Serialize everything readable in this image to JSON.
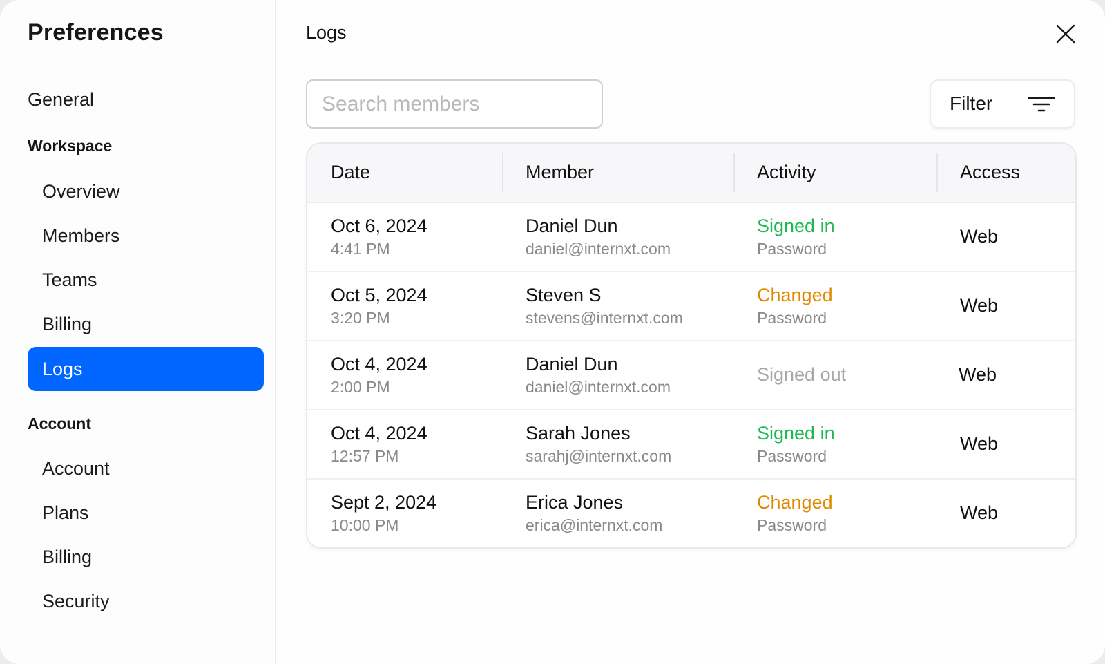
{
  "sidebar": {
    "title": "Preferences",
    "general": "General",
    "sections": [
      {
        "heading": "Workspace",
        "items": [
          "Overview",
          "Members",
          "Teams",
          "Billing",
          "Logs"
        ]
      },
      {
        "heading": "Account",
        "items": [
          "Account",
          "Plans",
          "Billing",
          "Security"
        ]
      }
    ],
    "active_item": "Logs"
  },
  "main": {
    "title": "Logs",
    "search": {
      "placeholder": "Search members",
      "value": ""
    },
    "filter_label": "Filter",
    "icons": {
      "close": "close-icon",
      "filter": "filter-lines-icon"
    },
    "colors": {
      "accent": "#0066ff",
      "signed_in": "#1fb954",
      "changed": "#e08a00",
      "signed_out": "#a8a8a8"
    },
    "table": {
      "columns": [
        "Date",
        "Member",
        "Activity",
        "Access"
      ],
      "rows": [
        {
          "date": "Oct 6, 2024",
          "time": "4:41 PM",
          "name": "Daniel Dun",
          "email": "daniel@internxt.com",
          "activity": "Signed in",
          "activity_detail": "Password",
          "access": "Web"
        },
        {
          "date": "Oct 5, 2024",
          "time": "3:20 PM",
          "name": "Steven S",
          "email": "stevens@internxt.com",
          "activity": "Changed",
          "activity_detail": "Password",
          "access": "Web"
        },
        {
          "date": "Oct 4, 2024",
          "time": "2:00 PM",
          "name": "Daniel Dun",
          "email": "daniel@internxt.com",
          "activity": "Signed out",
          "activity_detail": "",
          "access": "Web"
        },
        {
          "date": "Oct 4, 2024",
          "time": "12:57 PM",
          "name": "Sarah Jones",
          "email": "sarahj@internxt.com",
          "activity": "Signed in",
          "activity_detail": "Password",
          "access": "Web"
        },
        {
          "date": "Sept 2, 2024",
          "time": "10:00 PM",
          "name": "Erica Jones",
          "email": "erica@internxt.com",
          "activity": "Changed",
          "activity_detail": "Password",
          "access": "Web"
        }
      ]
    }
  }
}
